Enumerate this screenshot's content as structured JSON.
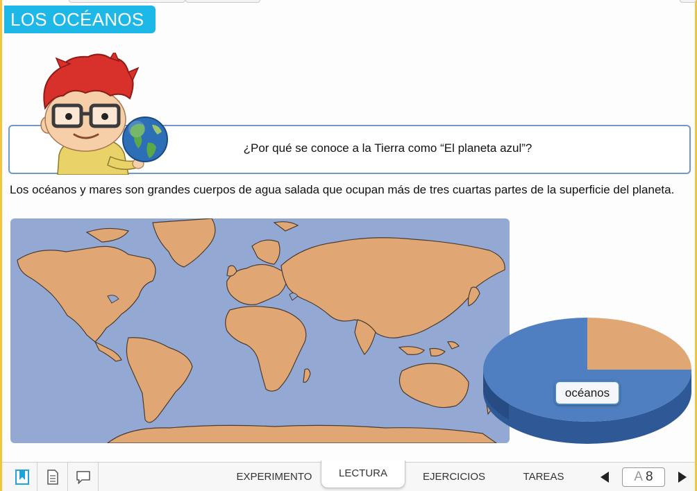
{
  "title": "LOS OCÉANOS",
  "question": "¿Por qué se conoce a la Tierra como “El planeta azul”?",
  "intro": "Los océanos y mares son grandes cuerpos de agua salada que ocupan más de tres cuartas partes de la superficie del planeta.",
  "illustration": {
    "character": "boy-with-globe",
    "map": "world-map"
  },
  "pie": {
    "label": "océanos",
    "oceans_fraction": 0.75,
    "colors": {
      "oceans": "#4f7fc0",
      "land": "#e0a774"
    }
  },
  "toolbar": {
    "icons": [
      "bookmark-icon",
      "document-icon",
      "comment-icon"
    ],
    "tabs": [
      "EXPERIMENTO",
      "LECTURA",
      "EJERCICIOS",
      "TAREAS"
    ],
    "active_tab": "LECTURA",
    "page_prefix": "A",
    "page_number": "8"
  },
  "colors": {
    "accent": "#1db8e8",
    "frame": "#f2c53d",
    "ocean": "#93a9d4",
    "land": "#e0a774"
  }
}
